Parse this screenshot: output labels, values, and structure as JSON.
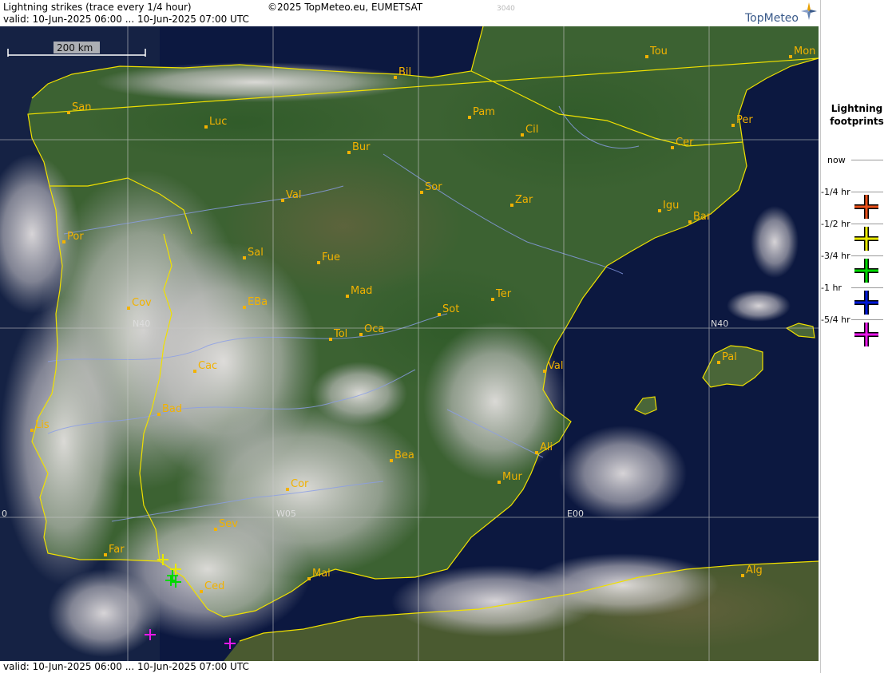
{
  "header": {
    "title": "Lightning strikes (trace every 1/4 hour)",
    "valid": "valid:  10-Jun-2025 06:00 ... 10-Jun-2025 07:00 UTC",
    "copyright": "©2025 TopMeteo.eu, EUMETSAT",
    "code": "3040",
    "logo": "TopMeteo"
  },
  "footer": {
    "valid": "valid:  10-Jun-2025 06:00 ... 10-Jun-2025 07:00 UTC"
  },
  "legend": {
    "title": "Lightning footprints",
    "items": [
      {
        "label": "now",
        "color": null
      },
      {
        "label": "-1/4 hr",
        "color": "#e8501a"
      },
      {
        "label": "-1/2 hr",
        "color": "#e8e800"
      },
      {
        "label": "-3/4 hr",
        "color": "#00d800"
      },
      {
        "label": "-1 hr",
        "color": "#0018d8"
      },
      {
        "label": "-5/4 hr",
        "color": "#e818e8"
      }
    ]
  },
  "map": {
    "scale_label": "200 km",
    "grid_labels": {
      "n40": "N40",
      "n40_east": "N40",
      "w05": "W05",
      "e00": "E00",
      "w10": "0"
    },
    "cities": [
      {
        "label": "Tou"
      },
      {
        "label": "Mon"
      },
      {
        "label": "Bil"
      },
      {
        "label": "San"
      },
      {
        "label": "Pam"
      },
      {
        "label": "Cil"
      },
      {
        "label": "Luc"
      },
      {
        "label": "Per"
      },
      {
        "label": "Bur"
      },
      {
        "label": "Cer"
      },
      {
        "label": "Sor"
      },
      {
        "label": "Val"
      },
      {
        "label": "Zar"
      },
      {
        "label": "Igu"
      },
      {
        "label": "Bar"
      },
      {
        "label": "Por"
      },
      {
        "label": "Sal"
      },
      {
        "label": "Fue"
      },
      {
        "label": "Mad"
      },
      {
        "label": "Ter"
      },
      {
        "label": "Cov"
      },
      {
        "label": "EBa"
      },
      {
        "label": "Sot"
      },
      {
        "label": "Tol"
      },
      {
        "label": "Oca"
      },
      {
        "label": "Pal"
      },
      {
        "label": "Cac"
      },
      {
        "label": "Val"
      },
      {
        "label": "Bad"
      },
      {
        "label": "Lis"
      },
      {
        "label": "Bea"
      },
      {
        "label": "Ali"
      },
      {
        "label": "Mur"
      },
      {
        "label": "Cor"
      },
      {
        "label": "Sev"
      },
      {
        "label": "Far"
      },
      {
        "label": "Alg"
      },
      {
        "label": "Mal"
      },
      {
        "label": "Ced"
      }
    ],
    "strikes": [
      {
        "age": "-1/2 hr",
        "color": "#e8e800"
      },
      {
        "age": "-1/2 hr",
        "color": "#e8e800"
      },
      {
        "age": "-3/4 hr",
        "color": "#00d800"
      },
      {
        "age": "-3/4 hr",
        "color": "#00d800"
      },
      {
        "age": "-3/4 hr",
        "color": "#00d800"
      },
      {
        "age": "-5/4 hr",
        "color": "#e818e8"
      },
      {
        "age": "-5/4 hr",
        "color": "#e818e8"
      }
    ],
    "colors": {
      "sea": "#0c1840",
      "land": "#3a6030",
      "coast": "#f0e000",
      "rivers": "#8a9ee8",
      "grid": "#c8c8c8",
      "city": "#f2b200"
    }
  }
}
